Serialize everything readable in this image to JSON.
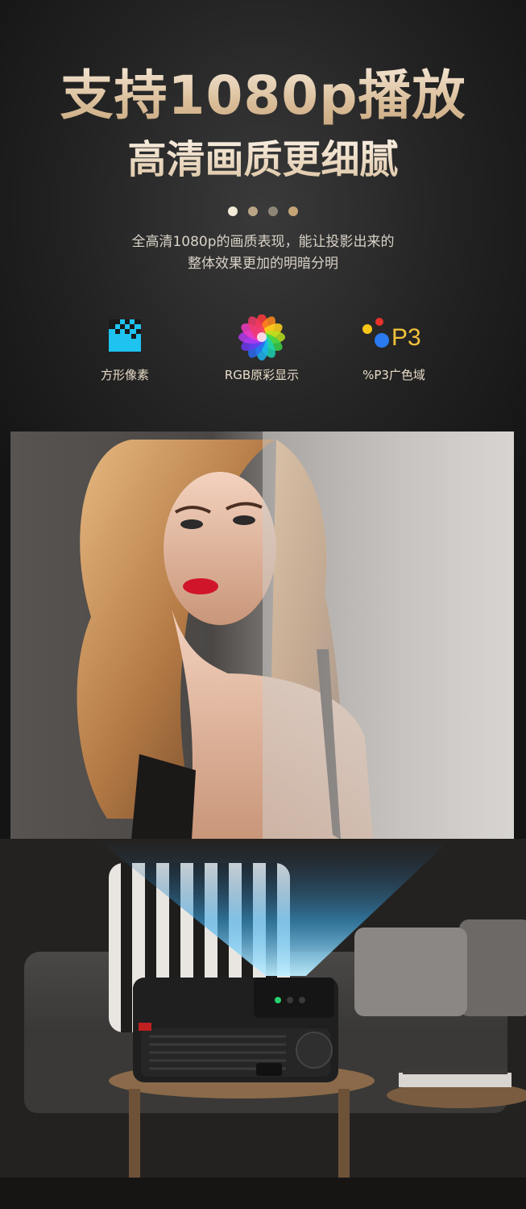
{
  "header": {
    "title": "支持1080p播放",
    "subtitle": "高清画质更细腻",
    "description_line1": "全高清1080p的画质表现，能让投影出来的",
    "description_line2": "整体效果更加的明暗分明"
  },
  "features": [
    {
      "label": "方形像素",
      "icon": "square-pixel-icon"
    },
    {
      "label": "RGB原彩显示",
      "icon": "rgb-flower-icon"
    },
    {
      "label": "%P3广色域",
      "icon": "p3-gamut-icon"
    }
  ],
  "p3_icon_text": "P3",
  "colors": {
    "gold_text": "#d9bd98",
    "pixel_icon": "#1ec3f0",
    "background": "#1a1a1a"
  }
}
